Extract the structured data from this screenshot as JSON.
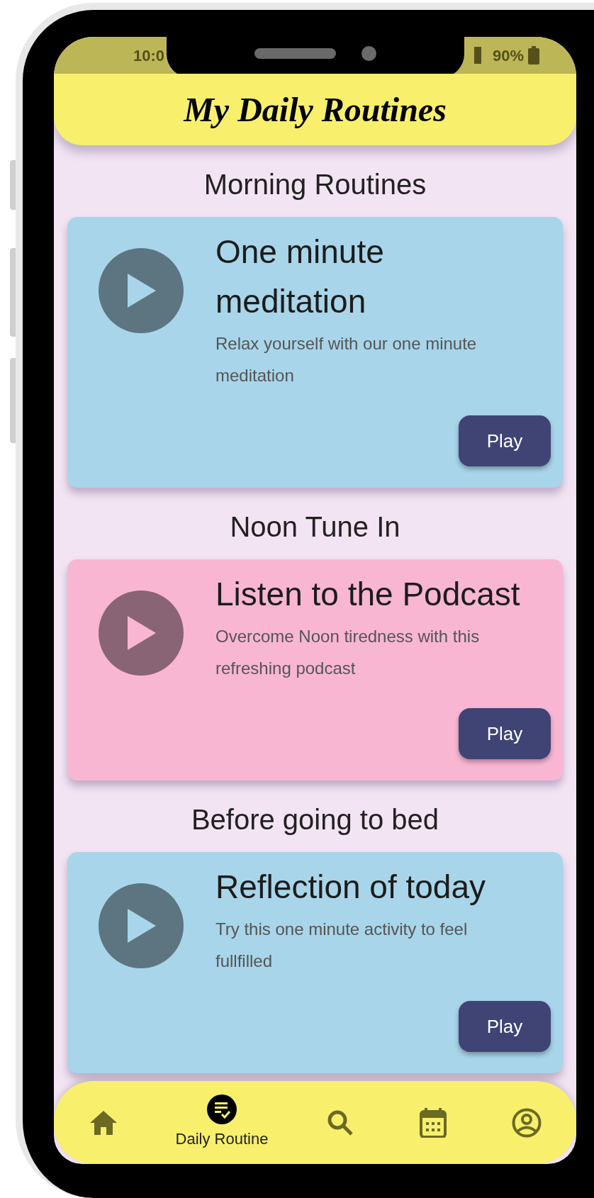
{
  "status_bar": {
    "time": "10:0",
    "battery": "90%"
  },
  "header": {
    "title": "My Daily Routines"
  },
  "sections": [
    {
      "heading": "Morning Routines",
      "card": {
        "title": "One minute meditation",
        "description": "Relax yourself with our one minute meditation",
        "button": "Play",
        "color": "#a8d5e9"
      }
    },
    {
      "heading": "Noon Tune In",
      "card": {
        "title": "Listen to the Podcast",
        "description": "Overcome Noon tiredness with this refreshing podcast",
        "button": "Play",
        "color": "#f8b6d3"
      }
    },
    {
      "heading": "Before going to bed",
      "card": {
        "title": "Reflection of today",
        "description": "Try this one minute activity to feel fullfilled",
        "button": "Play",
        "color": "#a8d5e9"
      }
    }
  ],
  "bottom_nav": [
    {
      "selected": false
    },
    {
      "label": "Daily Routine",
      "selected": true
    },
    {
      "selected": false
    },
    {
      "selected": false
    },
    {
      "selected": false
    }
  ]
}
